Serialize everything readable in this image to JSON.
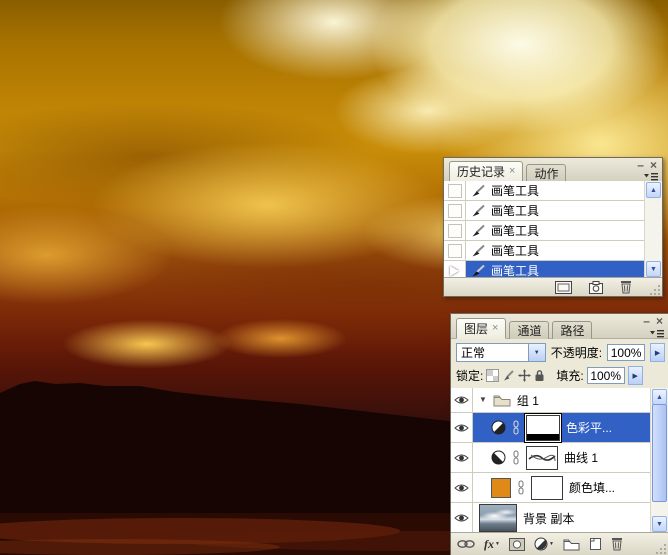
{
  "history_panel": {
    "tabs": [
      {
        "label": "历史记录",
        "close": "×",
        "active": true
      },
      {
        "label": "动作",
        "active": false
      }
    ],
    "window_buttons": {
      "minimize": "–",
      "close": "×"
    },
    "entries": [
      {
        "label": "画笔工具",
        "selected": false
      },
      {
        "label": "画笔工具",
        "selected": false
      },
      {
        "label": "画笔工具",
        "selected": false
      },
      {
        "label": "画笔工具",
        "selected": false
      },
      {
        "label": "画笔工具",
        "selected": true
      }
    ]
  },
  "layers_panel": {
    "tabs": [
      {
        "label": "图层",
        "close": "×",
        "active": true
      },
      {
        "label": "通道",
        "active": false
      },
      {
        "label": "路径",
        "active": false
      }
    ],
    "window_buttons": {
      "minimize": "–",
      "close": "×"
    },
    "blend_mode_value": "正常",
    "opacity_label": "不透明度:",
    "opacity_value": "100%",
    "lock_label": "锁定:",
    "fill_label": "填充:",
    "fill_value": "100%",
    "layers": [
      {
        "name": "组 1",
        "type": "group"
      },
      {
        "name": "色彩平...",
        "type": "adjustment-color-balance",
        "selected": true
      },
      {
        "name": "曲线 1",
        "type": "adjustment-curves"
      },
      {
        "name": "颜色填...",
        "type": "fill-color",
        "swatch": "#DF8A18"
      },
      {
        "name": "背景 副本",
        "type": "image"
      }
    ]
  },
  "icons": {
    "up_arrow": "▲",
    "down_arrow": "▼",
    "right_arrow": "▶",
    "dropdown": "▼",
    "expanded": "▼",
    "fx": "fx"
  },
  "colors": {
    "selection_blue": "#3161C4",
    "panel_chrome": "#ECE9D8",
    "swatch_orange": "#DF8A18"
  }
}
